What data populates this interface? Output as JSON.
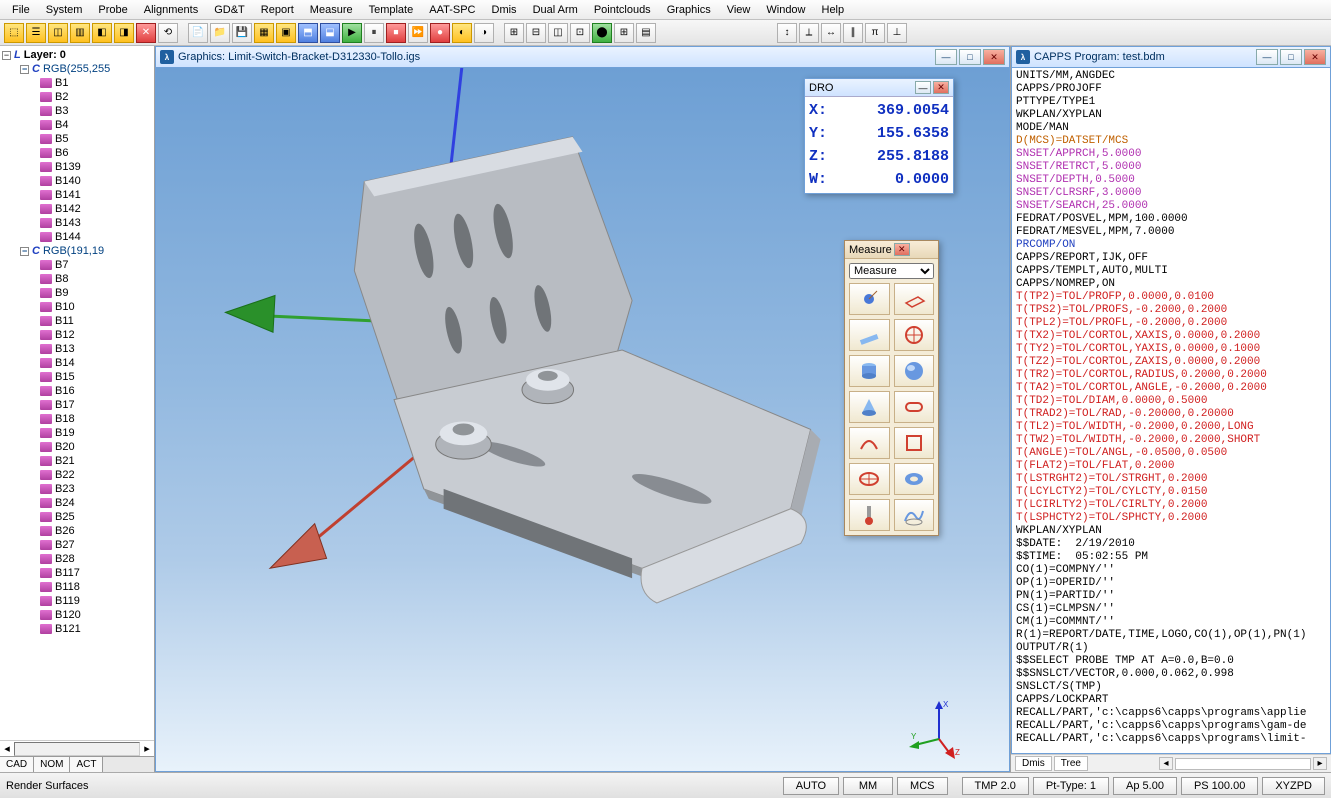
{
  "menu": [
    "File",
    "System",
    "Probe",
    "Alignments",
    "GD&T",
    "Report",
    "Measure",
    "Template",
    "AAT-SPC",
    "Dmis",
    "Dual Arm",
    "Pointclouds",
    "Graphics",
    "View",
    "Window",
    "Help"
  ],
  "graphics_window": {
    "title": "Graphics: Limit-Switch-Bracket-D312330-Tollo.igs"
  },
  "capps_window": {
    "title": "CAPPS Program: test.bdm"
  },
  "layer_panel": {
    "root": "Layer: 0",
    "group1_label": "RGB(255,255",
    "group1": [
      "B1",
      "B2",
      "B3",
      "B4",
      "B5",
      "B6",
      "B139",
      "B140",
      "B141",
      "B142",
      "B143",
      "B144"
    ],
    "group2_label": "RGB(191,19",
    "group2": [
      "B7",
      "B8",
      "B9",
      "B10",
      "B11",
      "B12",
      "B13",
      "B14",
      "B15",
      "B16",
      "B17",
      "B18",
      "B19",
      "B20",
      "B21",
      "B22",
      "B23",
      "B24",
      "B25",
      "B26",
      "B27",
      "B28",
      "B117",
      "B118",
      "B119",
      "B120",
      "B121"
    ],
    "tabs": [
      "CAD",
      "NOM",
      "ACT"
    ]
  },
  "dro": {
    "title": "DRO",
    "x_label": "X:",
    "x": "369.0054",
    "y_label": "Y:",
    "y": "155.6358",
    "z_label": "Z:",
    "z": "255.8188",
    "w_label": "W:",
    "w": "0.0000"
  },
  "measure": {
    "title": "Measure",
    "selected": "Measure"
  },
  "program_lines": [
    {
      "c": "blk",
      "t": "UNITS/MM,ANGDEC"
    },
    {
      "c": "blk",
      "t": "CAPPS/PROJOFF"
    },
    {
      "c": "blk",
      "t": "PTTYPE/TYPE1"
    },
    {
      "c": "blk",
      "t": "WKPLAN/XYPLAN"
    },
    {
      "c": "blk",
      "t": "MODE/MAN"
    },
    {
      "c": "org",
      "t": "D(MCS)=DATSET/MCS"
    },
    {
      "c": "mag",
      "t": "SNSET/APPRCH,5.0000"
    },
    {
      "c": "mag",
      "t": "SNSET/RETRCT,5.0000"
    },
    {
      "c": "mag",
      "t": "SNSET/DEPTH,0.5000"
    },
    {
      "c": "mag",
      "t": "SNSET/CLRSRF,3.0000"
    },
    {
      "c": "mag",
      "t": "SNSET/SEARCH,25.0000"
    },
    {
      "c": "blk",
      "t": "FEDRAT/POSVEL,MPM,100.0000"
    },
    {
      "c": "blk",
      "t": "FEDRAT/MESVEL,MPM,7.0000"
    },
    {
      "c": "blu",
      "t": "PRCOMP/ON"
    },
    {
      "c": "blk",
      "t": "CAPPS/REPORT,IJK,OFF"
    },
    {
      "c": "blk",
      "t": "CAPPS/TEMPLT,AUTO,MULTI"
    },
    {
      "c": "blk",
      "t": "CAPPS/NOMREP,ON"
    },
    {
      "c": "red",
      "t": "T(TP2)=TOL/PROFP,0.0000,0.0100"
    },
    {
      "c": "red",
      "t": "T(TPS2)=TOL/PROFS,-0.2000,0.2000"
    },
    {
      "c": "red",
      "t": "T(TPL2)=TOL/PROFL,-0.2000,0.2000"
    },
    {
      "c": "red",
      "t": "T(TX2)=TOL/CORTOL,XAXIS,0.0000,0.2000"
    },
    {
      "c": "red",
      "t": "T(TY2)=TOL/CORTOL,YAXIS,0.0000,0.1000"
    },
    {
      "c": "red",
      "t": "T(TZ2)=TOL/CORTOL,ZAXIS,0.0000,0.2000"
    },
    {
      "c": "red",
      "t": "T(TR2)=TOL/CORTOL,RADIUS,0.2000,0.2000"
    },
    {
      "c": "red",
      "t": "T(TA2)=TOL/CORTOL,ANGLE,-0.2000,0.2000"
    },
    {
      "c": "red",
      "t": "T(TD2)=TOL/DIAM,0.0000,0.5000"
    },
    {
      "c": "red",
      "t": "T(TRAD2)=TOL/RAD,-0.20000,0.20000"
    },
    {
      "c": "red",
      "t": "T(TL2)=TOL/WIDTH,-0.2000,0.2000,LONG"
    },
    {
      "c": "red",
      "t": "T(TW2)=TOL/WIDTH,-0.2000,0.2000,SHORT"
    },
    {
      "c": "red",
      "t": "T(ANGLE)=TOL/ANGL,-0.0500,0.0500"
    },
    {
      "c": "red",
      "t": "T(FLAT2)=TOL/FLAT,0.2000"
    },
    {
      "c": "red",
      "t": "T(LSTRGHT2)=TOL/STRGHT,0.2000"
    },
    {
      "c": "red",
      "t": "T(LCYLCTY2)=TOL/CYLCTY,0.0150"
    },
    {
      "c": "red",
      "t": "T(LCIRLTY2)=TOL/CIRLTY,0.2000"
    },
    {
      "c": "red",
      "t": "T(LSPHCTY2)=TOL/SPHCTY,0.2000"
    },
    {
      "c": "blk",
      "t": "WKPLAN/XYPLAN"
    },
    {
      "c": "blk",
      "t": "$$DATE:  2/19/2010"
    },
    {
      "c": "blk",
      "t": "$$TIME:  05:02:55 PM"
    },
    {
      "c": "blk",
      "t": "CO(1)=COMPNY/''"
    },
    {
      "c": "blk",
      "t": "OP(1)=OPERID/''"
    },
    {
      "c": "blk",
      "t": "PN(1)=PARTID/''"
    },
    {
      "c": "blk",
      "t": "CS(1)=CLMPSN/''"
    },
    {
      "c": "blk",
      "t": "CM(1)=COMMNT/''"
    },
    {
      "c": "blk",
      "t": "R(1)=REPORT/DATE,TIME,LOGO,CO(1),OP(1),PN(1)"
    },
    {
      "c": "blk",
      "t": "OUTPUT/R(1)"
    },
    {
      "c": "blk",
      "t": "$$SELECT PROBE TMP AT A=0.0,B=0.0"
    },
    {
      "c": "blk",
      "t": "$$SNSLCT/VECTOR,0.000,0.062,0.998"
    },
    {
      "c": "blk",
      "t": "SNSLCT/S(TMP)"
    },
    {
      "c": "blk",
      "t": "CAPPS/LOCKPART"
    },
    {
      "c": "blk",
      "t": "RECALL/PART,'c:\\capps6\\capps\\programs\\applie"
    },
    {
      "c": "blk",
      "t": "RECALL/PART,'c:\\capps6\\capps\\programs\\gam-de"
    },
    {
      "c": "blk",
      "t": "RECALL/PART,'c:\\capps6\\capps\\programs\\limit-"
    }
  ],
  "capps_tabs": [
    "Dmis",
    "Tree"
  ],
  "status": {
    "left": "Render Surfaces",
    "buttons": [
      "AUTO",
      "MM",
      "MCS",
      "TMP 2.0",
      "Pt-Type: 1",
      "Ap 5.00",
      "PS 100.00",
      "XYZPD"
    ]
  }
}
